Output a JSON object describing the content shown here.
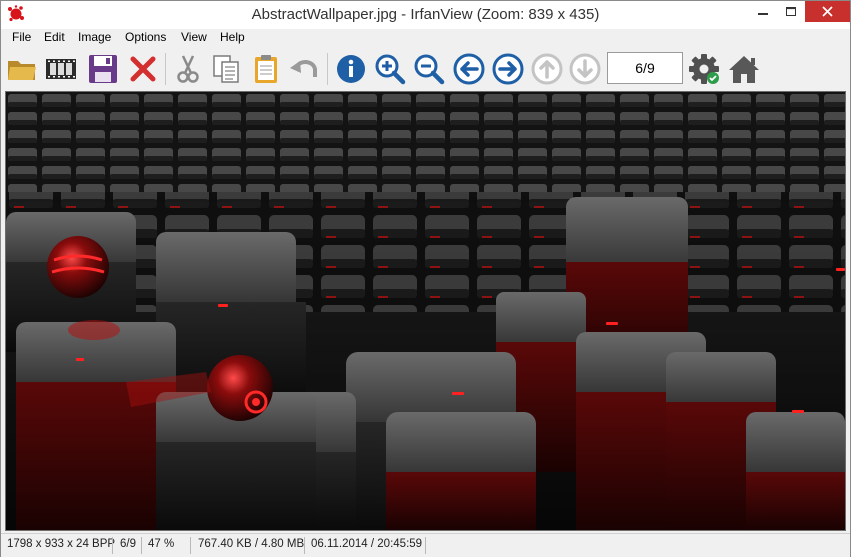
{
  "window": {
    "title": "AbstractWallpaper.jpg - IrfanView (Zoom: 839 x 435)"
  },
  "menu": [
    "File",
    "Edit",
    "Image",
    "Options",
    "View",
    "Help"
  ],
  "toolbar": {
    "buttons": [
      "open-folder",
      "slideshow",
      "save",
      "delete",
      "cut",
      "copy",
      "paste",
      "undo",
      "info",
      "zoom-in",
      "zoom-out",
      "previous",
      "next",
      "upload-up",
      "download-down",
      "settings",
      "home"
    ],
    "page_indicator": "6/9"
  },
  "status": {
    "dimensions": "1798 x 933 x 24 BPP",
    "index": "6/9",
    "zoom": "47 %",
    "size": "767.40 KB / 4.80 MB",
    "datetime": "06.11.2014 / 20:45:59"
  },
  "colors": {
    "accent_blue": "#1f5fa6",
    "delete_red": "#d32f2f",
    "save_purple": "#6a3a8a",
    "image_red": "#e11b1b"
  }
}
